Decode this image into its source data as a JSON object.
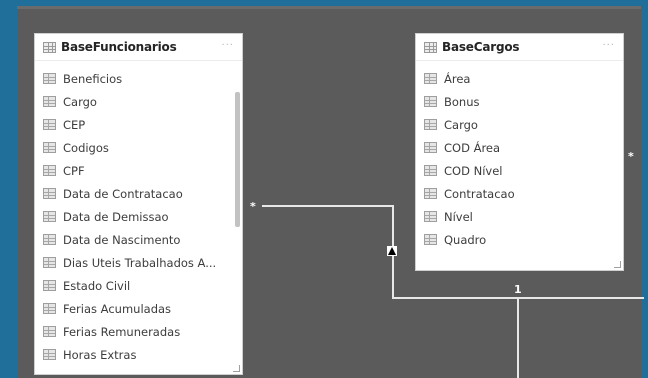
{
  "tables": [
    {
      "title": "BaseFuncionarios",
      "menu": "···",
      "fields": [
        "Beneficios",
        "Cargo",
        "CEP",
        "Codigos",
        "CPF",
        "Data de Contratacao",
        "Data de Demissao",
        "Data de Nascimento",
        "Dias Uteis Trabalhados A...",
        "Estado Civil",
        "Ferias Acumuladas",
        "Ferias Remuneradas",
        "Horas Extras"
      ]
    },
    {
      "title": "BaseCargos",
      "menu": "···",
      "fields": [
        "Área",
        "Bonus",
        "Cargo",
        "COD Área",
        "COD Nível",
        "Contratacao",
        "Nível",
        "Quadro"
      ]
    }
  ],
  "relationship": {
    "from_cardinality": "*",
    "to_cardinality": "1",
    "right_cardinality": "*"
  }
}
